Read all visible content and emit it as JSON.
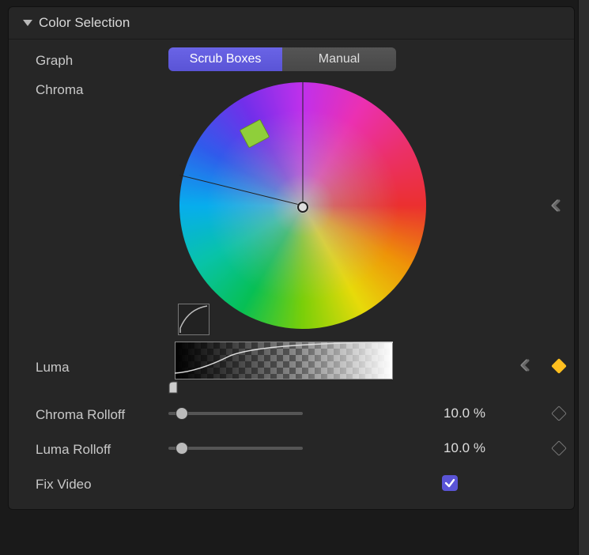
{
  "section": {
    "title": "Color Selection"
  },
  "graph": {
    "label": "Graph",
    "seg": {
      "scrub": "Scrub Boxes",
      "manual": "Manual",
      "active": "scrub"
    }
  },
  "chroma": {
    "label": "Chroma",
    "reset_icon": "reset-arrow-icon",
    "keyframe_active": true
  },
  "luma": {
    "label": "Luma",
    "reset_icon": "reset-arrow-icon",
    "keyframe_active": true
  },
  "chroma_rolloff": {
    "label": "Chroma Rolloff",
    "value": "10.0",
    "unit": "%",
    "slider_percent": 10,
    "keyframe_active": false
  },
  "luma_rolloff": {
    "label": "Luma Rolloff",
    "value": "10.0",
    "unit": "%",
    "slider_percent": 10,
    "keyframe_active": false
  },
  "fix_video": {
    "label": "Fix Video",
    "checked": true
  }
}
